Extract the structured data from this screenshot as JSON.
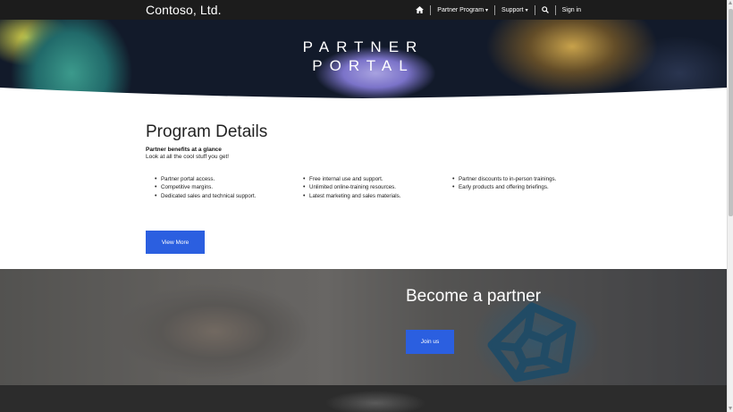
{
  "header": {
    "brand": "Contoso, Ltd.",
    "nav": [
      {
        "label": "Partner Program",
        "caret": "▾"
      },
      {
        "label": "Support",
        "caret": "▾"
      }
    ],
    "home_icon": "home-icon",
    "search_icon": "search-icon",
    "sign_in": "Sign in"
  },
  "hero": {
    "title_line1": "PARTNER",
    "title_line2": "PORTAL"
  },
  "program": {
    "heading": "Program Details",
    "subheading": "Partner benefits at a glance",
    "subtext": "Look at all the cool stuff you get!",
    "columns": [
      [
        "Partner portal access.",
        "Competitive margins.",
        "Dedicated sales and technical support."
      ],
      [
        "Free internal use and support.",
        "Unlimited online-training resources.",
        "Latest marketing and sales materials."
      ],
      [
        "Partner discounts to in-person trainings.",
        "Early products and offering briefings."
      ]
    ],
    "button": "View More"
  },
  "partner": {
    "heading": "Become a partner",
    "button": "Join us"
  },
  "colors": {
    "accent": "#2b5fe0",
    "nav_bg": "#1c1c1c"
  }
}
